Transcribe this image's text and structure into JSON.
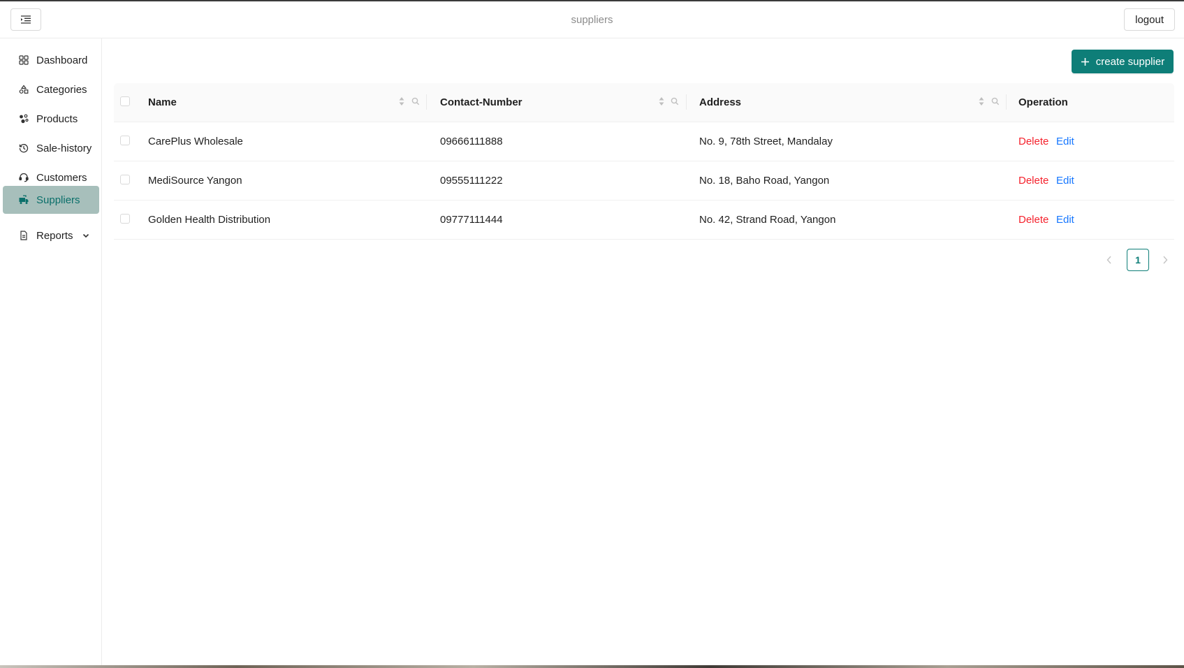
{
  "header": {
    "title": "suppliers",
    "logout_label": "logout",
    "menu_icon": "menu-fold-icon"
  },
  "sidebar": {
    "items": [
      {
        "label": "Dashboard",
        "icon": "dashboard-icon"
      },
      {
        "label": "Categories",
        "icon": "categories-icon"
      },
      {
        "label": "Products",
        "icon": "products-icon"
      },
      {
        "label": "Sale-history",
        "icon": "history-icon"
      },
      {
        "label": "Customers",
        "icon": "customer-service-icon"
      },
      {
        "label": "Suppliers",
        "icon": "truck-icon",
        "active": true
      },
      {
        "label": "Reports",
        "icon": "file-icon",
        "expandable": true
      }
    ]
  },
  "toolbar": {
    "create_label": "create supplier"
  },
  "table": {
    "columns": [
      "Name",
      "Contact-Number",
      "Address",
      "Operation"
    ],
    "rows": [
      {
        "name": "CarePlus Wholesale",
        "contact": "09666111888",
        "address": "No. 9, 78th Street, Mandalay"
      },
      {
        "name": "MediSource Yangon",
        "contact": "09555111222",
        "address": "No. 18, Baho Road, Yangon"
      },
      {
        "name": "Golden Health Distribution",
        "contact": "09777111444",
        "address": "No. 42, Strand Road, Yangon"
      }
    ],
    "actions": {
      "delete_label": "Delete",
      "edit_label": "Edit"
    }
  },
  "pagination": {
    "current_page": "1"
  },
  "colors": {
    "accent": "#0e7e78",
    "active_nav_bg": "#a7bfbb",
    "delete": "#f5222d",
    "edit": "#1677ff"
  }
}
